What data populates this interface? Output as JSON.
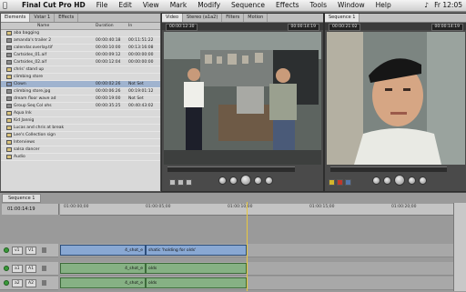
{
  "menubar": {
    "app_name": "Final Cut Pro HD",
    "items": [
      "File",
      "Edit",
      "View",
      "Mark",
      "Modify",
      "Sequence",
      "Effects",
      "Tools",
      "Window",
      "Help"
    ],
    "clock": "Fr 12:05"
  },
  "browser": {
    "tabs": [
      "Elements",
      "Vstar 1",
      "Effects"
    ],
    "columns": [
      "Name",
      "Duration",
      "In"
    ],
    "rows": [
      {
        "name": "aba bagging",
        "dur": "",
        "in": "",
        "type": "bin"
      },
      {
        "name": "amanda's trailer 2",
        "dur": "00:00:40:18",
        "in": "00:11:51:22",
        "type": "clip"
      },
      {
        "name": "calendar.overlay.tif",
        "dur": "00:00:10:00",
        "in": "00:13:16:08",
        "type": "clip"
      },
      {
        "name": "Cartsides_01.aif",
        "dur": "00:00:09:12",
        "in": "00:00:00:00",
        "type": "clip"
      },
      {
        "name": "Cartsides_02.aif",
        "dur": "00:00:12:04",
        "in": "00:00:00:00",
        "type": "clip"
      },
      {
        "name": "chris' stand up",
        "dur": "",
        "in": "",
        "type": "bin"
      },
      {
        "name": "climbing store",
        "dur": "",
        "in": "",
        "type": "bin"
      },
      {
        "name": "Clown",
        "dur": "00:00:02:26",
        "in": "Not Set",
        "type": "seq",
        "selected": true
      },
      {
        "name": "climbing store.jpg",
        "dur": "00:00:06:26",
        "in": "00:19:01:12",
        "type": "clip"
      },
      {
        "name": "dream floor wave ad",
        "dur": "00:00:19:00",
        "in": "Not Set",
        "type": "clip"
      },
      {
        "name": "Group Seq Col ohs",
        "dur": "00:00:35:25",
        "in": "00:40:43:02",
        "type": "clip"
      },
      {
        "name": "Aqua Ink",
        "dur": "",
        "in": "",
        "type": "bin"
      },
      {
        "name": "Kid Jannig",
        "dur": "",
        "in": "",
        "type": "bin"
      },
      {
        "name": "Lucas and chris at break",
        "dur": "",
        "in": "",
        "type": "bin"
      },
      {
        "name": "Lee's Collection sign",
        "dur": "",
        "in": "",
        "type": "bin"
      },
      {
        "name": "Interviews",
        "dur": "",
        "in": "",
        "type": "bin"
      },
      {
        "name": "salsa dancer",
        "dur": "",
        "in": "",
        "type": "bin"
      },
      {
        "name": "Audio",
        "dur": "",
        "in": "",
        "type": "bin"
      }
    ]
  },
  "viewer": {
    "tabs": [
      "Video",
      "Stereo (a1a2)",
      "Filters",
      "Motion"
    ],
    "timecode_left": "00:00:12:30",
    "timecode_right": "00:00:14:19"
  },
  "canvas": {
    "tabs": [
      "Sequence 1"
    ],
    "timecode_left": "00:00:21:02",
    "timecode_right": "00:00:14:19"
  },
  "timeline": {
    "tab_label": "Sequence 1",
    "timecode": "01:00:14:19",
    "ruler_ticks": [
      "01:00:00;00",
      "01:00:05;00",
      "01:00:10;00",
      "01:00:15;00",
      "01:00:20;00"
    ],
    "tracks": [
      {
        "id": "v1",
        "label1": "v1",
        "label2": "V1",
        "clips": [
          {
            "label": "4_shot_e"
          },
          {
            "label": "shatic 'holding for olds'"
          }
        ]
      },
      {
        "id": "a1",
        "label1": "a1",
        "label2": "A1",
        "clips": [
          {
            "label": "4_shot_e"
          },
          {
            "label": "olds"
          }
        ]
      },
      {
        "id": "a2",
        "label1": "a2",
        "label2": "A2",
        "clips": [
          {
            "label": "4_shot_e"
          },
          {
            "label": "olds"
          }
        ]
      }
    ]
  },
  "colors": {
    "video_clip": "#89a8d3",
    "audio_clip": "#86b184",
    "playhead": "#e8c840",
    "selection": "#9fb3cf"
  }
}
